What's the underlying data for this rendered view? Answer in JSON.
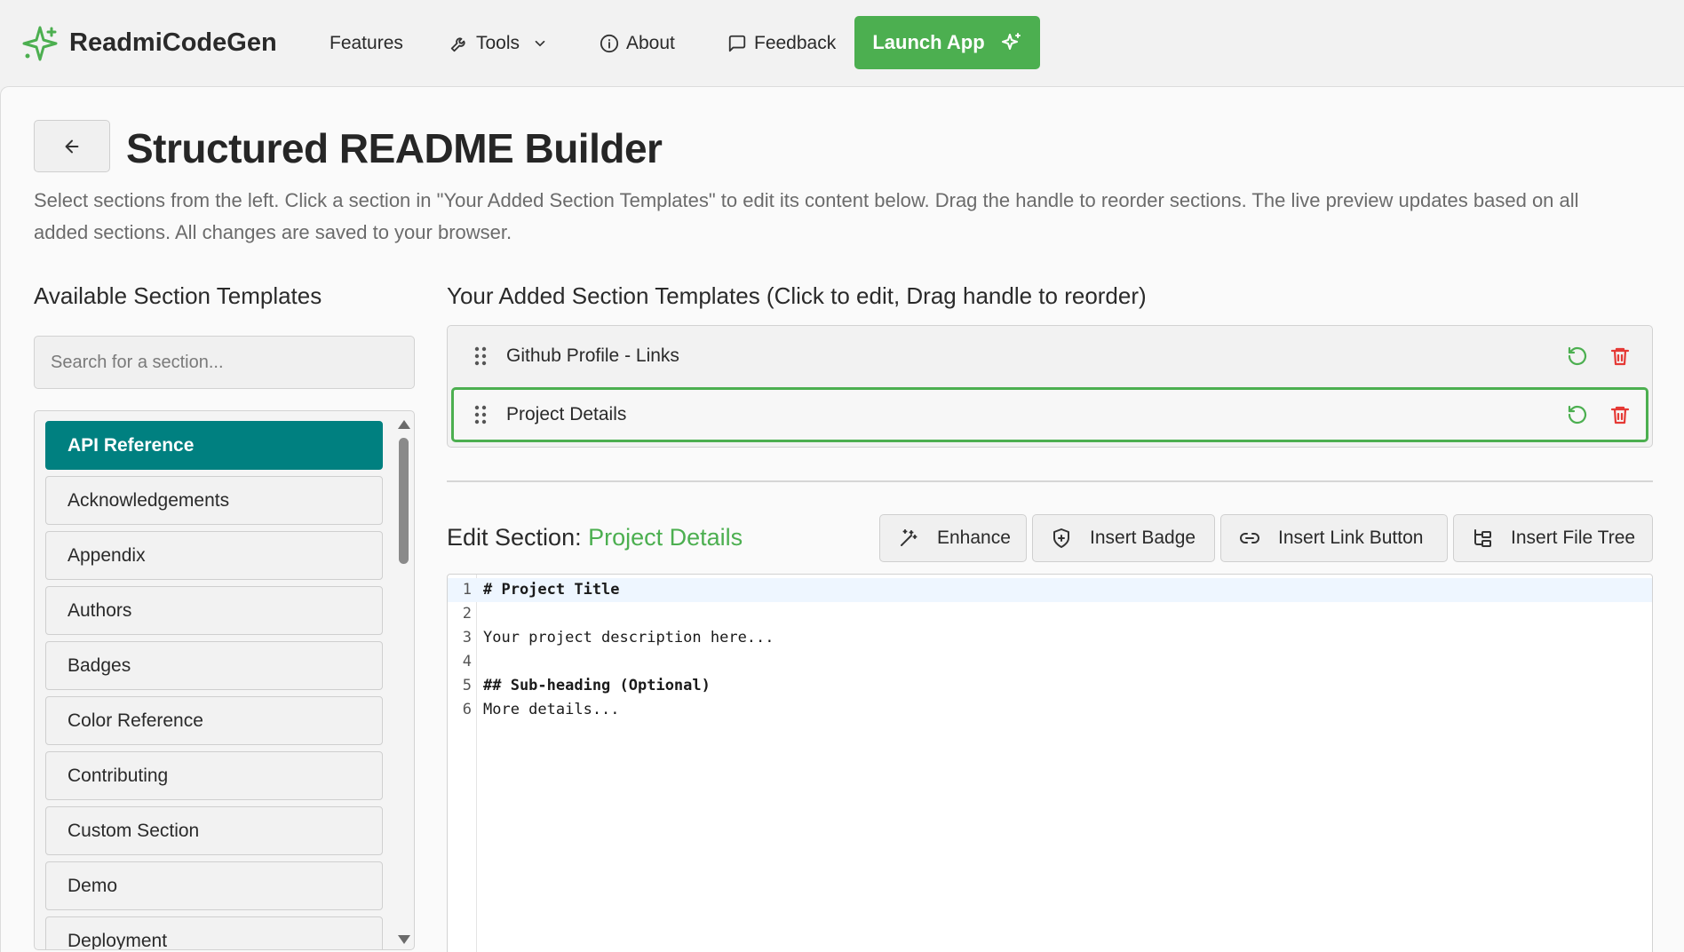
{
  "app": {
    "brand_name": "ReadmiCodeGen",
    "accent_color": "#4caf50",
    "active_color": "#008080"
  },
  "nav": {
    "features": "Features",
    "tools": "Tools",
    "about": "About",
    "feedback": "Feedback",
    "launch": "Launch App"
  },
  "page": {
    "title": "Structured README Builder",
    "description": "Select sections from the left. Click a section in \"Your Added Section Templates\" to edit its content below. Drag the handle to reorder sections. The live preview updates based on all added sections. All changes are saved to your browser."
  },
  "available": {
    "heading": "Available Section Templates",
    "search_placeholder": "Search for a section...",
    "items": [
      "API Reference",
      "Acknowledgements",
      "Appendix",
      "Authors",
      "Badges",
      "Color Reference",
      "Contributing",
      "Custom Section",
      "Demo",
      "Deployment"
    ],
    "active_index": 0
  },
  "added": {
    "heading": "Your Added Section Templates (Click to edit, Drag handle to reorder)",
    "items": [
      "Github Profile - Links",
      "Project Details"
    ],
    "selected_index": 1
  },
  "edit": {
    "prefix": "Edit Section: ",
    "section_name": "Project Details",
    "toolbar": {
      "enhance": "Enhance",
      "insert_badge": "Insert Badge",
      "insert_link": "Insert Link Button",
      "insert_tree": "Insert File Tree"
    },
    "lines": [
      {
        "n": "1",
        "text": "# Project Title"
      },
      {
        "n": "2",
        "text": ""
      },
      {
        "n": "3",
        "text": "Your project description here..."
      },
      {
        "n": "4",
        "text": ""
      },
      {
        "n": "5",
        "text": "## Sub-heading (Optional)"
      },
      {
        "n": "6",
        "text": "More details..."
      }
    ]
  }
}
